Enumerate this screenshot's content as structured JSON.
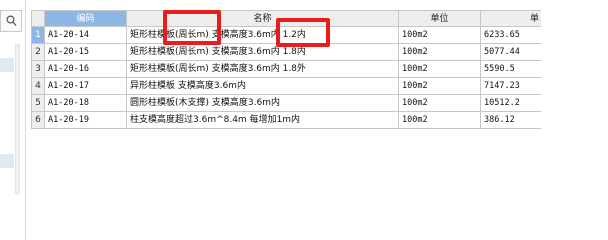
{
  "table": {
    "columns": [
      "",
      "编码",
      "名称",
      "单位",
      "单"
    ],
    "rows": [
      {
        "n": "1",
        "code": "A1-20-14",
        "name": "矩形柱模板(周长m) 支模高度3.6m内 1.2内",
        "unit": "100m2",
        "price": "6233.65"
      },
      {
        "n": "2",
        "code": "A1-20-15",
        "name": "矩形柱模板(周长m) 支模高度3.6m内 1.8内",
        "unit": "100m2",
        "price": "5077.44"
      },
      {
        "n": "3",
        "code": "A1-20-16",
        "name": "矩形柱模板(周长m) 支模高度3.6m内 1.8外",
        "unit": "100m2",
        "price": "5590.5"
      },
      {
        "n": "4",
        "code": "A1-20-17",
        "name": "异形柱模板 支模高度3.6m内",
        "unit": "100m2",
        "price": "7147.23"
      },
      {
        "n": "5",
        "code": "A1-20-18",
        "name": "圆形柱模板(木支撑) 支模高度3.6m内",
        "unit": "100m2",
        "price": "10512.2"
      },
      {
        "n": "6",
        "code": "A1-20-19",
        "name": "柱支模高度超过3.6m^8.4m 每增加1m内",
        "unit": "100m2",
        "price": "386.12"
      }
    ]
  },
  "sidebar": {
    "search_icon": "search-icon"
  },
  "colors": {
    "header_selected": "#8db8e6",
    "annotation": "#ea1d1d"
  }
}
